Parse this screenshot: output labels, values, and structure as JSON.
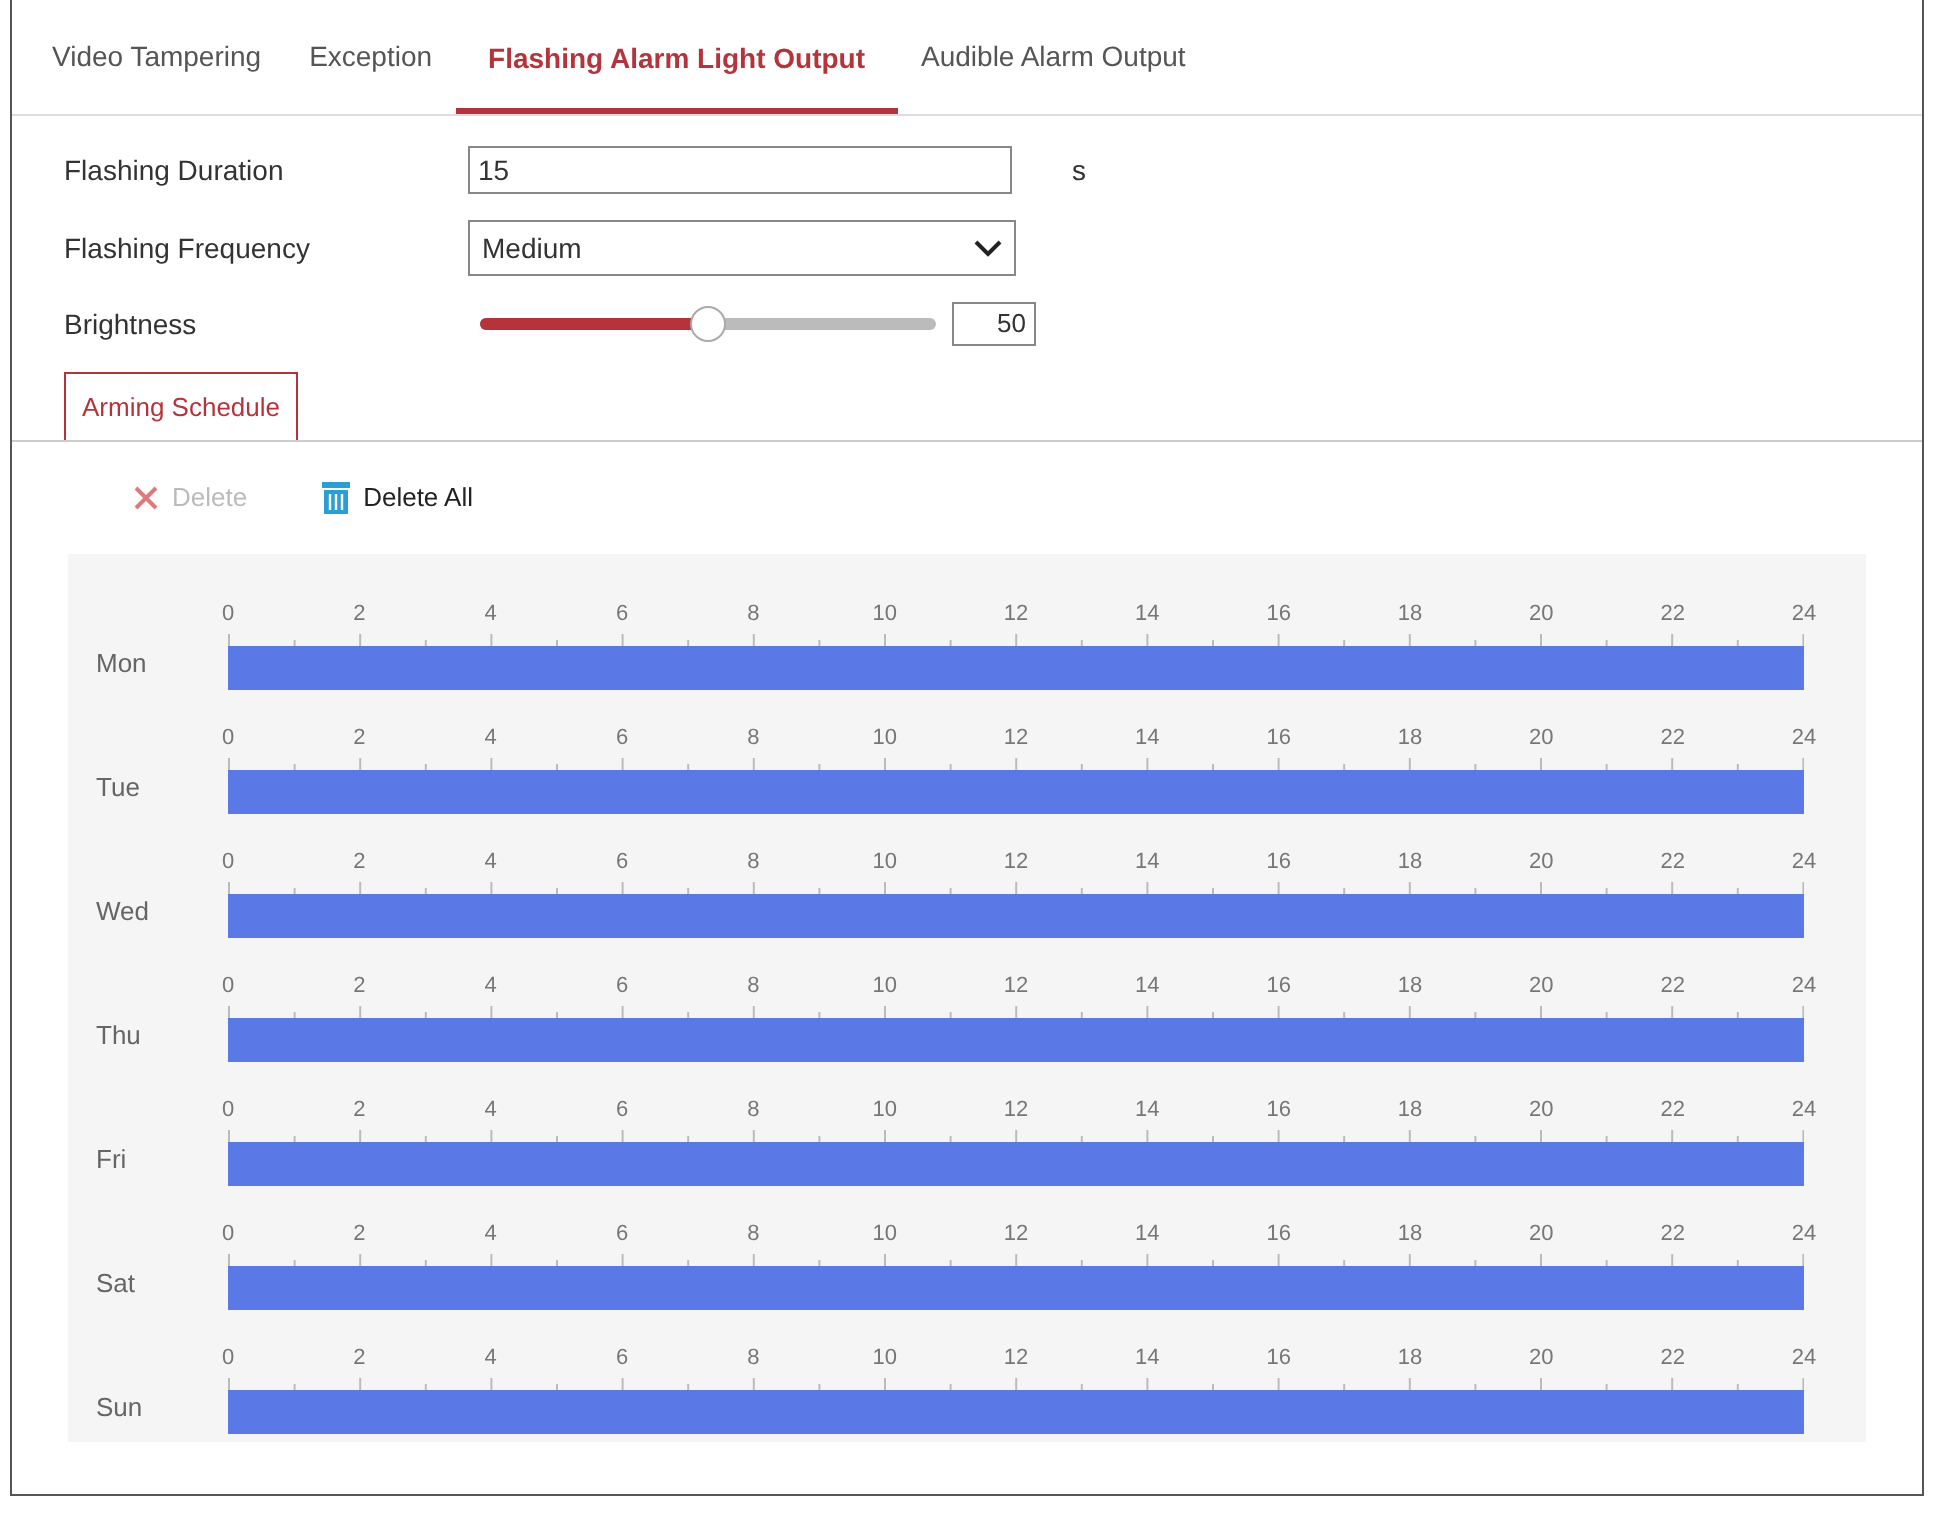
{
  "tabs": [
    {
      "label": "Video Tampering",
      "selected": false
    },
    {
      "label": "Exception",
      "selected": false
    },
    {
      "label": "Flashing Alarm Light Output",
      "selected": true
    },
    {
      "label": "Audible Alarm Output",
      "selected": false
    }
  ],
  "form": {
    "duration": {
      "label": "Flashing Duration",
      "value": "15",
      "unit": "s"
    },
    "frequency": {
      "label": "Flashing Frequency",
      "value": "Medium"
    },
    "brightness": {
      "label": "Brightness",
      "level": 0.5,
      "reading": "50"
    }
  },
  "schedule_tab": {
    "label": "Arming Schedule"
  },
  "toolbar": [
    {
      "kind": "delete",
      "label": "Delete",
      "disabled": true
    },
    {
      "kind": "delete_all",
      "label": "Delete All",
      "disabled": false
    }
  ],
  "schedule": [
    {
      "day": "Mon",
      "level": 1,
      "ticks": [
        "0",
        "2",
        "4",
        "6",
        "8",
        "10",
        "12",
        "14",
        "16",
        "18",
        "20",
        "22",
        "24"
      ]
    },
    {
      "day": "Tue",
      "level": 1,
      "ticks": [
        "0",
        "2",
        "4",
        "6",
        "8",
        "10",
        "12",
        "14",
        "16",
        "18",
        "20",
        "22",
        "24"
      ]
    },
    {
      "day": "Wed",
      "level": 1,
      "ticks": [
        "0",
        "2",
        "4",
        "6",
        "8",
        "10",
        "12",
        "14",
        "16",
        "18",
        "20",
        "22",
        "24"
      ]
    },
    {
      "day": "Thu",
      "level": 1,
      "ticks": [
        "0",
        "2",
        "4",
        "6",
        "8",
        "10",
        "12",
        "14",
        "16",
        "18",
        "20",
        "22",
        "24"
      ]
    },
    {
      "day": "Fri",
      "level": 1,
      "ticks": [
        "0",
        "2",
        "4",
        "6",
        "8",
        "10",
        "12",
        "14",
        "16",
        "18",
        "20",
        "22",
        "24"
      ]
    },
    {
      "day": "Sat",
      "level": 1,
      "ticks": [
        "0",
        "2",
        "4",
        "6",
        "8",
        "10",
        "12",
        "14",
        "16",
        "18",
        "20",
        "22",
        "24"
      ]
    },
    {
      "day": "Sun",
      "level": 1,
      "ticks": [
        "0",
        "2",
        "4",
        "6",
        "8",
        "10",
        "12",
        "14",
        "16",
        "18",
        "20",
        "22",
        "24"
      ]
    }
  ]
}
